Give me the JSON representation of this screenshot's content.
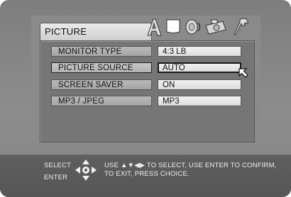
{
  "colors": {
    "screen_bg": "#858585",
    "panel_bg": "#767676",
    "bottom_bar_bg": "#5a5a5a"
  },
  "menu": {
    "tab_title": "PICTURE",
    "tab_icons": [
      "letter-a-icon",
      "page-icon",
      "sound-icon",
      "camera-icon",
      "wrench-icon"
    ],
    "rows": [
      {
        "label": "MONITOR TYPE",
        "value": "4:3 LB",
        "selected": false
      },
      {
        "label": "PICTURE SOURCE",
        "value": "AUTO",
        "selected": true
      },
      {
        "label": "SCREEN SAVER",
        "value": "ON",
        "selected": false
      },
      {
        "label": "MP3 / JPEG",
        "value": "MP3",
        "selected": false
      }
    ]
  },
  "bottom_bar": {
    "select_label": "SELECT",
    "enter_label": "ENTER",
    "icon": "dpad-icon",
    "help_line1": "USE ▲▼◀▶ TO SELECT,  USE ENTER TO CONFIRM,",
    "help_line2": "TO EXIT, PRESS CHOICE."
  },
  "cursor": {
    "icon": "pointer-arrow-icon"
  }
}
